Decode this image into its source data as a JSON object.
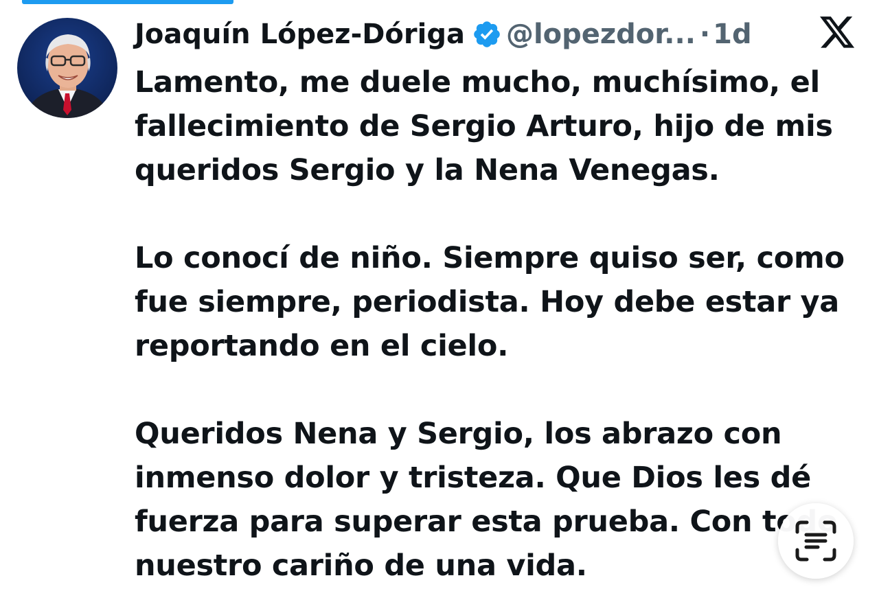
{
  "tweet": {
    "author": {
      "display_name": "Joaquín López-Dóriga",
      "handle": "@lopezdor...",
      "verified": true,
      "avatar_icon": "profile-photo"
    },
    "separator": "·",
    "time": "1d",
    "platform_icon": "x-logo-icon",
    "paragraphs": [
      [
        "Lamento, me duele mucho, muchísimo, el",
        "fallecimiento de Sergio Arturo, hijo de mis",
        "queridos Sergio y la Nena Venegas."
      ],
      [
        "Lo conocí de niño. Siempre quiso ser, como",
        "fue siempre, periodista. Hoy debe estar ya",
        "reportando en el cielo."
      ],
      [
        "Queridos Nena y Sergio, los abrazo con",
        "inmenso dolor y tristeza. Que Dios les dé",
        "fuerza para superar esta prueba. Con todo",
        "nuestro cariño de una vida."
      ]
    ]
  },
  "overlay": {
    "live_text_icon": "live-text-scan-icon"
  },
  "colors": {
    "text_primary": "#0f1419",
    "text_secondary": "#536471",
    "accent": "#1d9bf0",
    "background": "#ffffff"
  }
}
